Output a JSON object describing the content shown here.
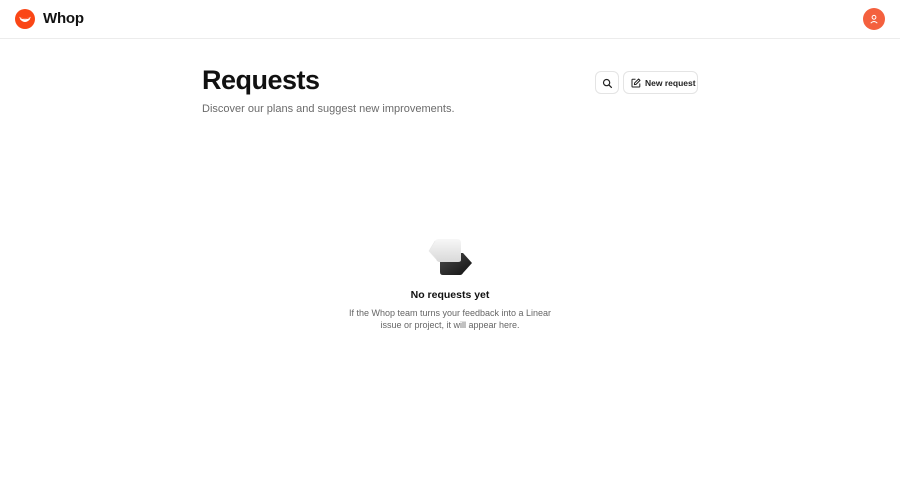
{
  "header": {
    "brand": "Whop",
    "logo_icon": "whop-logo-icon",
    "avatar_icon": "user-icon",
    "brand_color": "#fa4616",
    "avatar_color": "#f4603e"
  },
  "main": {
    "title": "Requests",
    "subtitle": "Discover our plans and suggest new improvements.",
    "search_icon": "search-icon",
    "new_request_icon": "edit-icon",
    "new_request_label": "New request"
  },
  "empty_state": {
    "illustration": "empty-box-icon",
    "title": "No requests yet",
    "description": "If the Whop team turns your feedback into a Linear issue or project, it will appear here."
  }
}
